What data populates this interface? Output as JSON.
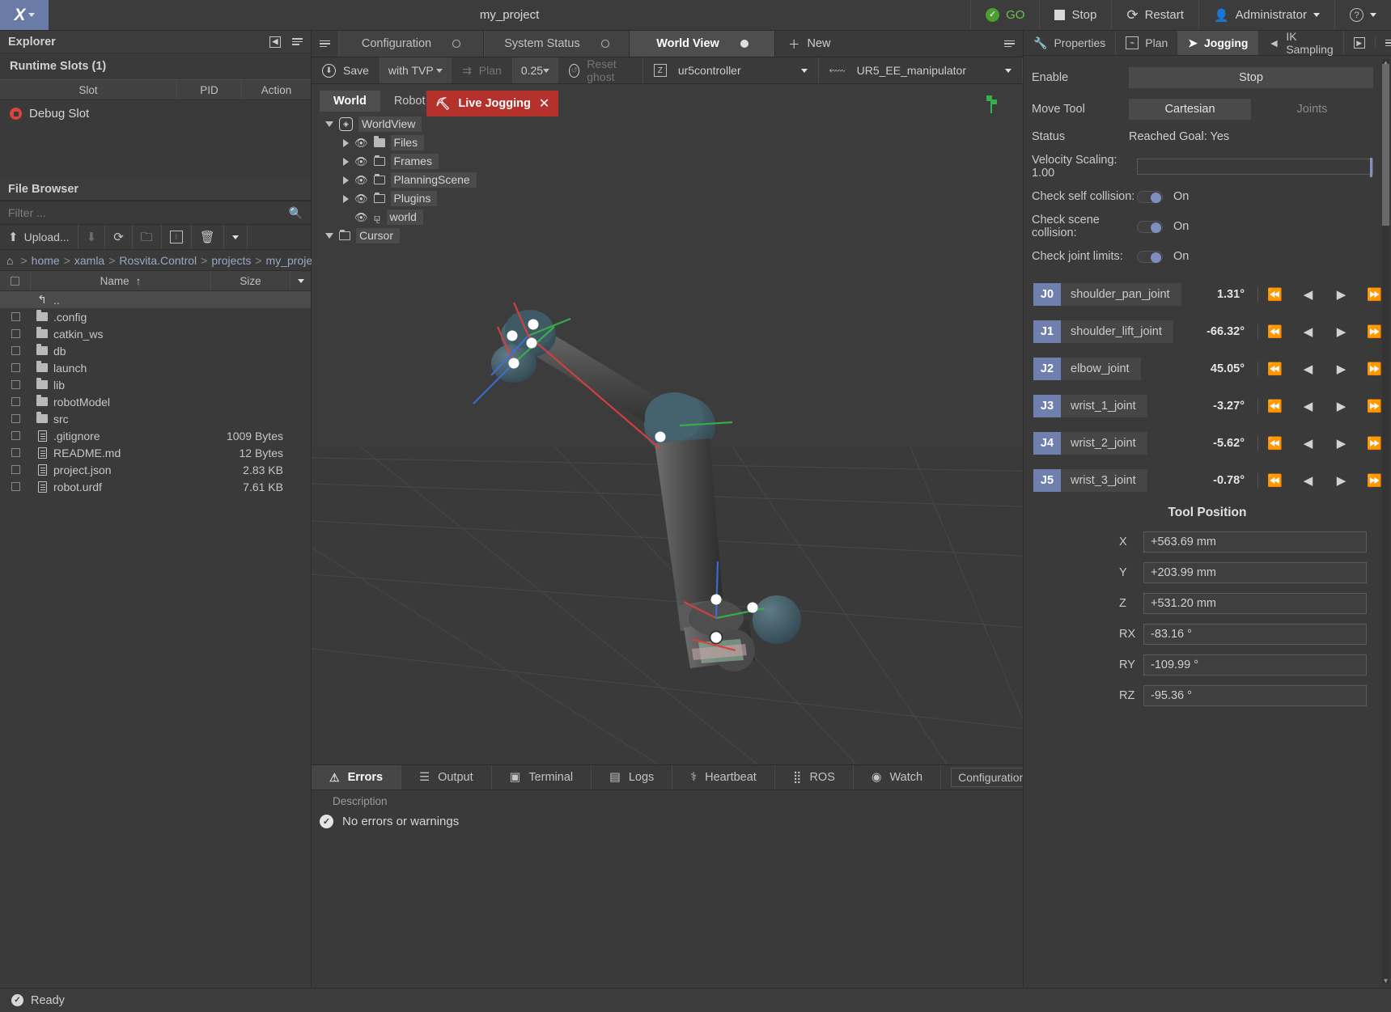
{
  "titlebar": {
    "logo": "logo-glyph",
    "project_title": "my_project",
    "go_label": "GO",
    "stop_label": "Stop",
    "restart_label": "Restart",
    "user_label": "Administrator",
    "help_label": "?"
  },
  "explorer": {
    "header": "Explorer",
    "runtime_slots_title": "Runtime Slots (1)",
    "columns": [
      "Slot",
      "PID",
      "Action"
    ],
    "slots": [
      {
        "name": "Debug Slot",
        "pid": "",
        "action": ""
      }
    ]
  },
  "file_browser": {
    "header": "File Browser",
    "filter_placeholder": "Filter ...",
    "filter_value": "",
    "toolbar": {
      "upload": "Upload...",
      "download": "download-icon",
      "refresh": "refresh-icon",
      "new_folder": "new-folder-icon",
      "rename": "rename-icon",
      "delete": "trash-icon",
      "more": "chevron-down-icon"
    },
    "breadcrumb": [
      "home",
      "xamla",
      "Rosvita.Control",
      "projects",
      "my_project"
    ],
    "columns": {
      "name": "Name",
      "size": "Size",
      "sort": "↑"
    },
    "rows": [
      {
        "name": "..",
        "size": "",
        "type": "up"
      },
      {
        "name": ".config",
        "size": "",
        "type": "folder"
      },
      {
        "name": "catkin_ws",
        "size": "",
        "type": "folder"
      },
      {
        "name": "db",
        "size": "",
        "type": "folder"
      },
      {
        "name": "launch",
        "size": "",
        "type": "folder"
      },
      {
        "name": "lib",
        "size": "",
        "type": "folder"
      },
      {
        "name": "robotModel",
        "size": "",
        "type": "folder"
      },
      {
        "name": "src",
        "size": "",
        "type": "folder"
      },
      {
        "name": ".gitignore",
        "size": "1009 Bytes",
        "type": "file"
      },
      {
        "name": "README.md",
        "size": "12 Bytes",
        "type": "file"
      },
      {
        "name": "project.json",
        "size": "2.83 KB",
        "type": "file"
      },
      {
        "name": "robot.urdf",
        "size": "7.61 KB",
        "type": "file"
      }
    ]
  },
  "center": {
    "tabs": [
      {
        "label": "Configuration",
        "active": false
      },
      {
        "label": "System Status",
        "active": false
      },
      {
        "label": "World View",
        "active": true
      }
    ],
    "new_tab_label": "New",
    "toolbar": {
      "save": "Save",
      "tvp_select": "with TVP",
      "plan": "Plan",
      "plan_value": "0.25",
      "reset_ghost": "Reset ghost",
      "controller_select": "ur5controller",
      "endeffector_select": "UR5_EE_manipulator"
    },
    "world_tabs": [
      {
        "label": "World",
        "active": true
      },
      {
        "label": "Robot",
        "active": false
      }
    ],
    "live_jogging_label": "Live Jogging",
    "tree": [
      {
        "label": "WorldView",
        "depth": 0,
        "icon": "worldview-icon",
        "expanded": true
      },
      {
        "label": "Files",
        "depth": 1,
        "icon": "folder-filled-icon",
        "expanded": false
      },
      {
        "label": "Frames",
        "depth": 1,
        "icon": "folder-outline-icon",
        "expanded": false
      },
      {
        "label": "PlanningScene",
        "depth": 1,
        "icon": "folder-outline-icon",
        "expanded": false
      },
      {
        "label": "Plugins",
        "depth": 1,
        "icon": "folder-outline-icon",
        "expanded": false
      },
      {
        "label": "world",
        "depth": 1,
        "icon": "axis-icon",
        "expanded": null
      },
      {
        "label": "Cursor",
        "depth": 0,
        "icon": "folder-outline-icon",
        "expanded": true
      }
    ]
  },
  "bottom": {
    "tabs": [
      {
        "label": "Errors",
        "icon": "warning-icon",
        "active": true
      },
      {
        "label": "Output",
        "icon": "output-icon",
        "active": false
      },
      {
        "label": "Terminal",
        "icon": "terminal-icon",
        "active": false
      },
      {
        "label": "Logs",
        "icon": "logs-icon",
        "active": false
      },
      {
        "label": "Heartbeat",
        "icon": "heartbeat-icon",
        "active": false
      },
      {
        "label": "ROS",
        "icon": "ros-icon",
        "active": false
      },
      {
        "label": "Watch",
        "icon": "watch-icon",
        "active": false
      }
    ],
    "config_select": "Configuration",
    "description_header": "Description",
    "empty_message": "No errors or warnings"
  },
  "right": {
    "tabs": [
      {
        "label": "Properties",
        "icon": "wrench-icon",
        "active": false
      },
      {
        "label": "Plan",
        "icon": "plan-icon",
        "active": false
      },
      {
        "label": "Jogging",
        "icon": "jogging-icon",
        "active": true
      },
      {
        "label": "IK Sampling",
        "icon": "ik-icon",
        "active": false
      }
    ],
    "jogging": {
      "enable_label": "Enable",
      "enable_button": "Stop",
      "move_tool_label": "Move Tool",
      "move_tool_cartesian": "Cartesian",
      "move_tool_joints": "Joints",
      "status_label": "Status",
      "status_value": "Reached Goal: Yes",
      "velocity_label": "Velocity Scaling: 1.00",
      "toggles": [
        {
          "label": "Check self collision:",
          "state": "On"
        },
        {
          "label": "Check scene collision:",
          "state": "On"
        },
        {
          "label": "Check joint limits:",
          "state": "On"
        }
      ],
      "joints": [
        {
          "id": "J0",
          "name": "shoulder_pan_joint",
          "value": "1.31°"
        },
        {
          "id": "J1",
          "name": "shoulder_lift_joint",
          "value": "-66.32°"
        },
        {
          "id": "J2",
          "name": "elbow_joint",
          "value": "45.05°"
        },
        {
          "id": "J3",
          "name": "wrist_1_joint",
          "value": "-3.27°"
        },
        {
          "id": "J4",
          "name": "wrist_2_joint",
          "value": "-5.62°"
        },
        {
          "id": "J5",
          "name": "wrist_3_joint",
          "value": "-0.78°"
        }
      ],
      "joint_buttons": [
        "⏪",
        "◀",
        "▶",
        "⏩"
      ],
      "tool_position_title": "Tool Position",
      "tool_position": [
        {
          "axis": "X",
          "value": "+563.69 mm"
        },
        {
          "axis": "Y",
          "value": "+203.99 mm"
        },
        {
          "axis": "Z",
          "value": "+531.20 mm"
        },
        {
          "axis": "RX",
          "value": "-83.16 °"
        },
        {
          "axis": "RY",
          "value": "-109.99 °"
        },
        {
          "axis": "RZ",
          "value": "-95.36 °"
        }
      ]
    }
  },
  "statusbar": {
    "text": "Ready"
  },
  "colors": {
    "accent_blue": "#6f80ae",
    "danger_red": "#b5312b",
    "success_green": "#4c9e31",
    "slot_red": "#d9453c"
  }
}
